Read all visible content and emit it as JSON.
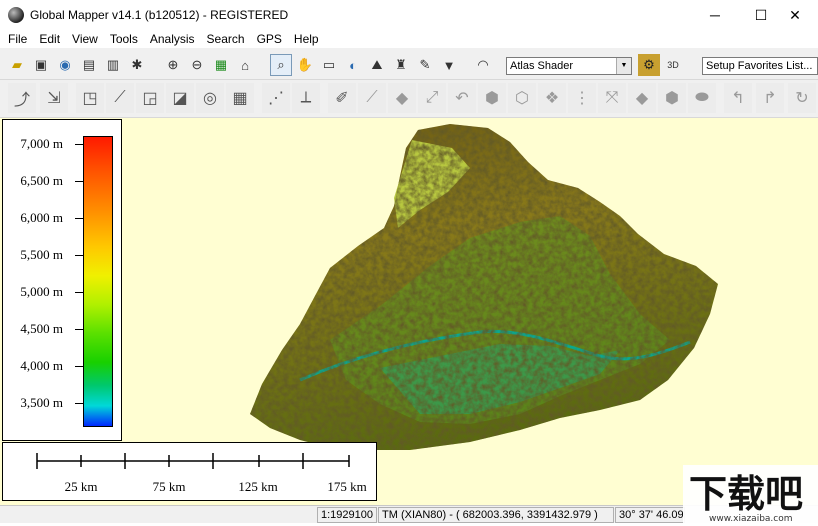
{
  "window": {
    "title": "Global Mapper v14.1 (b120512) - REGISTERED",
    "minimize": "─",
    "maximize": "☐",
    "close": "✕"
  },
  "menu": [
    "File",
    "Edit",
    "View",
    "Tools",
    "Analysis",
    "Search",
    "GPS",
    "Help"
  ],
  "toolbar": {
    "shader_value": "Atlas Shader",
    "favorites_value": "Setup Favorites List..."
  },
  "legend": {
    "labels": [
      "7,000 m",
      "6,500 m",
      "6,000 m",
      "5,500 m",
      "5,000 m",
      "4,500 m",
      "4,000 m",
      "3,500 m"
    ]
  },
  "scale": {
    "labels": [
      "25 km",
      "75 km",
      "125 km",
      "175 km"
    ]
  },
  "status": {
    "scale": "1:1929100",
    "projection": "TM (XIAN80) - ( 682003.396, 3391432.979 )",
    "latlon": "30° 37' 46.09"
  },
  "watermark": {
    "text": "下载吧",
    "url": "www.xiazaiba.com"
  },
  "colors": {
    "map_background": "#fffed2",
    "ramp_top": "#ff1a00",
    "ramp_bottom": "#0028ff"
  }
}
